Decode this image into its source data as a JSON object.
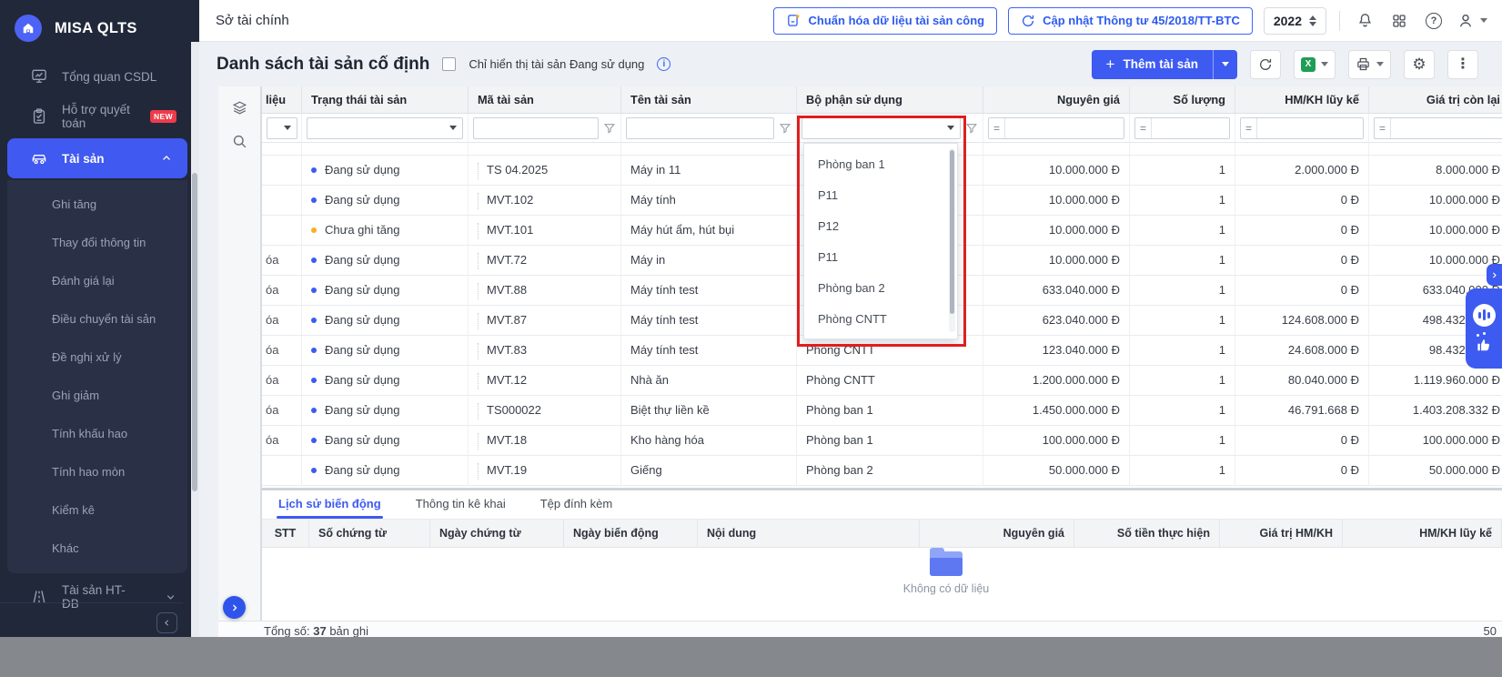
{
  "sidebar": {
    "logo_text": "MISA QLTS",
    "items": [
      {
        "label": "Tổng quan CSDL",
        "icon": "dashboard-icon"
      },
      {
        "label": "Hỗ trợ quyết toán",
        "icon": "clipboard-icon",
        "badge": "NEW"
      },
      {
        "label": "Tài sản",
        "icon": "car-icon",
        "active": true
      }
    ],
    "submenu": [
      "Ghi tăng",
      "Thay đổi thông tin",
      "Đánh giá lại",
      "Điều chuyển tài sản",
      "Đề nghị xử lý",
      "Ghi giảm",
      "Tính khấu hao",
      "Tính hao mòn",
      "Kiểm kê",
      "Khác"
    ],
    "secondary_item": "Tài sản HT-ĐB"
  },
  "topbar": {
    "breadcrumb": "Sở tài chính",
    "normalize_button": "Chuẩn hóa dữ liệu tài sản công",
    "update_button": "Cập nhật Thông tư 45/2018/TT-BTC",
    "year": "2022"
  },
  "page": {
    "title": "Danh sách tài sản cố định",
    "checkbox_label": "Chỉ hiển thị tài sản Đang sử dụng",
    "add_button": "Thêm tài sản"
  },
  "asset_table": {
    "partial_column": "liệu",
    "filter_operator": "=",
    "columns": [
      "Trạng thái tài sản",
      "Mã tài sản",
      "Tên tài sản",
      "Bộ phận sử dụng",
      "Nguyên giá",
      "Số lượng",
      "HM/KH lũy kế",
      "Giá trị còn lại"
    ],
    "rows": [
      {
        "lock": "",
        "status": "Đang sử dụng",
        "status_color": "blue",
        "code": "TS 04.2025",
        "name": "Máy in 11",
        "dept": "",
        "cost": "10.000.000 Đ",
        "qty": "1",
        "accum": "2.000.000 Đ",
        "remain": "8.000.000 Đ"
      },
      {
        "lock": "",
        "status": "Đang sử dụng",
        "status_color": "blue",
        "code": "MVT.102",
        "name": "Máy tính",
        "dept": "",
        "cost": "10.000.000 Đ",
        "qty": "1",
        "accum": "0 Đ",
        "remain": "10.000.000 Đ"
      },
      {
        "lock": "",
        "status": "Chưa ghi tăng",
        "status_color": "orange",
        "code": "MVT.101",
        "name": "Máy hút ẩm, hút bụi",
        "dept": "",
        "cost": "10.000.000 Đ",
        "qty": "1",
        "accum": "0 Đ",
        "remain": "10.000.000 Đ"
      },
      {
        "lock": "óa",
        "status": "Đang sử dụng",
        "status_color": "blue",
        "code": "MVT.72",
        "name": "Máy in",
        "dept": "",
        "cost": "10.000.000 Đ",
        "qty": "1",
        "accum": "0 Đ",
        "remain": "10.000.000 Đ"
      },
      {
        "lock": "óa",
        "status": "Đang sử dụng",
        "status_color": "blue",
        "code": "MVT.88",
        "name": "Máy tính test",
        "dept": "",
        "cost": "633.040.000 Đ",
        "qty": "1",
        "accum": "0 Đ",
        "remain": "633.040.000 Đ"
      },
      {
        "lock": "óa",
        "status": "Đang sử dụng",
        "status_color": "blue",
        "code": "MVT.87",
        "name": "Máy tính test",
        "dept": "",
        "cost": "623.040.000 Đ",
        "qty": "1",
        "accum": "124.608.000 Đ",
        "remain": "498.432.000 Đ"
      },
      {
        "lock": "óa",
        "status": "Đang sử dụng",
        "status_color": "blue",
        "code": "MVT.83",
        "name": "Máy tính test",
        "dept": "Phòng CNTT",
        "cost": "123.040.000 Đ",
        "qty": "1",
        "accum": "24.608.000 Đ",
        "remain": "98.432.000 Đ"
      },
      {
        "lock": "óa",
        "status": "Đang sử dụng",
        "status_color": "blue",
        "code": "MVT.12",
        "name": "Nhà ăn",
        "dept": "Phòng CNTT",
        "cost": "1.200.000.000 Đ",
        "qty": "1",
        "accum": "80.040.000 Đ",
        "remain": "1.119.960.000 Đ"
      },
      {
        "lock": "óa",
        "status": "Đang sử dụng",
        "status_color": "blue",
        "code": "TS000022",
        "name": "Biệt thự liền kề",
        "dept": "Phòng ban 1",
        "cost": "1.450.000.000 Đ",
        "qty": "1",
        "accum": "46.791.668 Đ",
        "remain": "1.403.208.332 Đ"
      },
      {
        "lock": "óa",
        "status": "Đang sử dụng",
        "status_color": "blue",
        "code": "MVT.18",
        "name": "Kho hàng hóa",
        "dept": "Phòng ban 1",
        "cost": "100.000.000 Đ",
        "qty": "1",
        "accum": "0 Đ",
        "remain": "100.000.000 Đ"
      },
      {
        "lock": "",
        "status": "Đang sử dụng",
        "status_color": "blue",
        "code": "MVT.19",
        "name": "Giếng",
        "dept": "Phòng ban 2",
        "cost": "50.000.000 Đ",
        "qty": "1",
        "accum": "0 Đ",
        "remain": "50.000.000 Đ"
      }
    ]
  },
  "dept_dropdown": {
    "options": [
      "Phòng ban 1",
      "P11",
      "P12",
      "P11",
      "Phòng ban 2",
      "Phòng CNTT"
    ]
  },
  "detail_panel": {
    "tabs": [
      "Lịch sử biến động",
      "Thông tin kê khai",
      "Tệp đính kèm"
    ],
    "active_tab_index": 0,
    "columns": [
      "STT",
      "Số chứng từ",
      "Ngày chứng từ",
      "Ngày biến động",
      "Nội dung",
      "Nguyên giá",
      "Số tiền thực hiện",
      "Giá trị HM/KH",
      "HM/KH lũy kế"
    ],
    "empty_text": "Không có dữ liệu"
  },
  "footer": {
    "total_prefix": "Tổng số:",
    "total_count": "37",
    "total_suffix": "bản ghi",
    "right_partial": "50"
  },
  "colors": {
    "accent": "#3d5af1",
    "annotation": "#e01e1e",
    "status_active": "#3b5bf0",
    "status_pending": "#f7b11e"
  }
}
